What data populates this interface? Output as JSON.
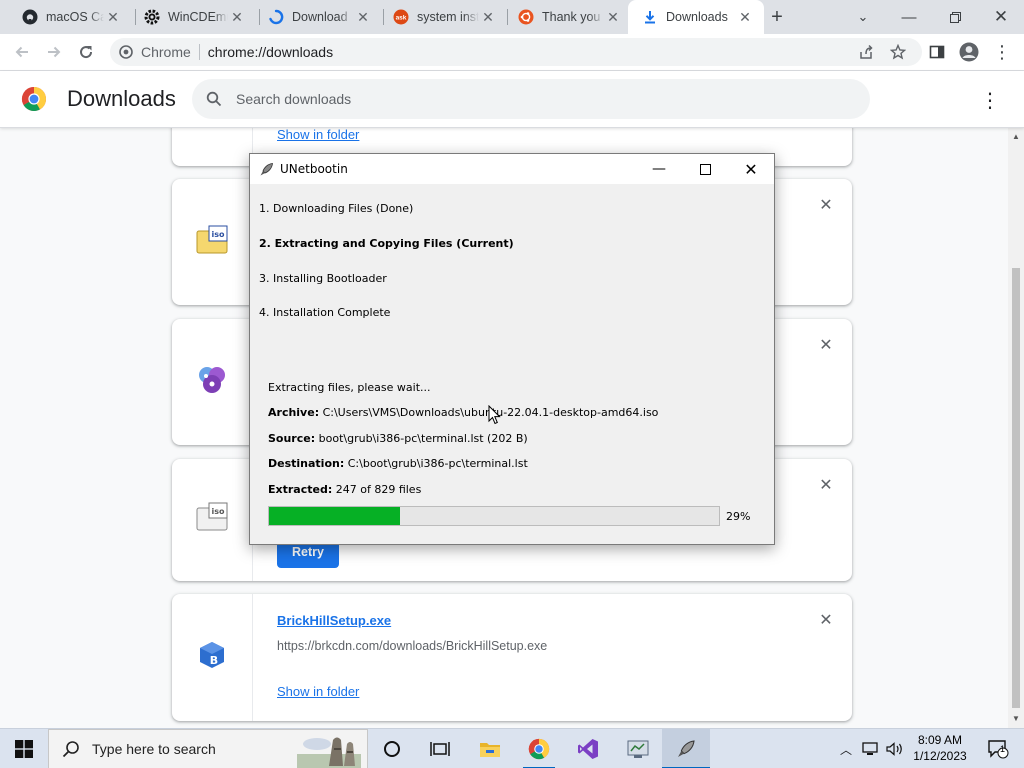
{
  "browser": {
    "tabs": [
      {
        "title": "macOS Catalina",
        "icon": "github-icon"
      },
      {
        "title": "WinCDEmu",
        "icon": "gear-icon"
      },
      {
        "title": "Download",
        "icon": "loading-icon"
      },
      {
        "title": "system insta",
        "icon": "askubuntu-icon"
      },
      {
        "title": "Thank you",
        "icon": "ubuntu-icon"
      },
      {
        "title": "Downloads",
        "icon": "download-icon",
        "active": true
      }
    ],
    "omnibox": {
      "site": "Chrome",
      "url": "chrome://downloads"
    }
  },
  "downloads": {
    "title": "Downloads",
    "search_placeholder": "Search downloads",
    "show_in_folder": "Show in folder",
    "retry_label": "Retry",
    "last_item": {
      "filename": "BrickHillSetup.exe",
      "url": "https://brkcdn.com/downloads/BrickHillSetup.exe",
      "show_in_folder": "Show in folder"
    }
  },
  "unetbootin": {
    "title": "UNetbootin",
    "steps": [
      "1. Downloading Files (Done)",
      "2. Extracting and Copying Files (Current)",
      "3. Installing Bootloader",
      "4. Installation Complete"
    ],
    "status": "Extracting files, please wait...",
    "archive_label": "Archive:",
    "archive_value": "C:\\Users\\VMS\\Downloads\\ubuntu-22.04.1-desktop-amd64.iso",
    "source_label": "Source:",
    "source_value": "boot\\grub\\i386-pc\\terminal.lst (202 B)",
    "destination_label": "Destination:",
    "destination_value": "C:\\boot\\grub\\i386-pc\\terminal.lst",
    "extracted_label": "Extracted:",
    "extracted_value": "247 of 829 files",
    "progress_percent": 29,
    "progress_text": "29%"
  },
  "taskbar": {
    "search_placeholder": "Type here to search",
    "time": "8:09 AM",
    "date": "1/12/2023",
    "notification_count": "1"
  }
}
